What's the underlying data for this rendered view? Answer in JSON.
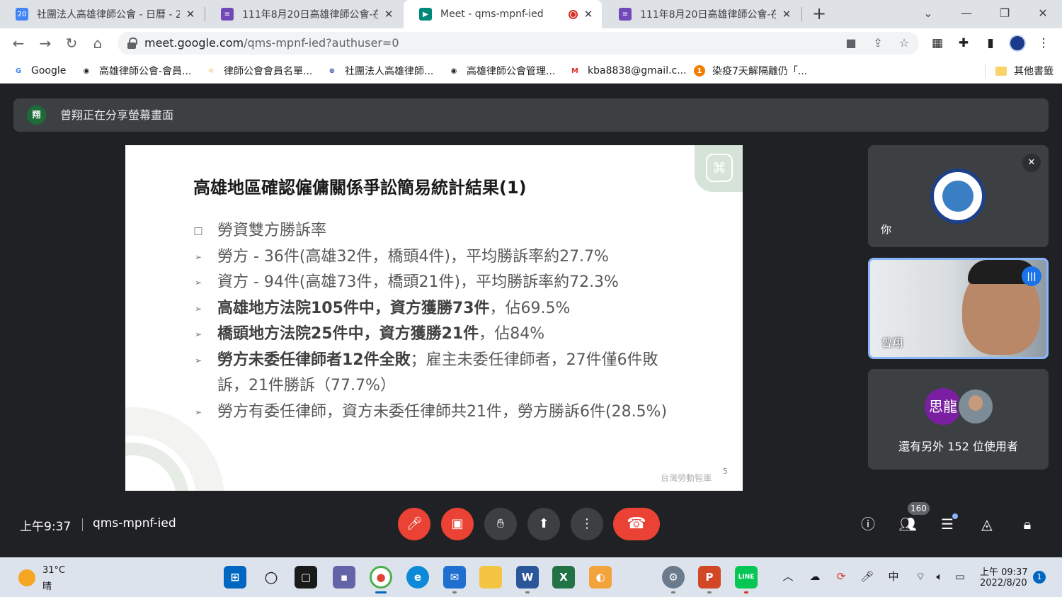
{
  "tabs": [
    {
      "title": "社團法人高雄律師公會 - 日曆 - 2",
      "favicon_text": "20",
      "favicon_color": "#4285f4"
    },
    {
      "title": "111年8月20日高雄律師公會-在",
      "favicon_text": "≡",
      "favicon_color": "#7248b9"
    },
    {
      "title": "Meet - qms-mpnf-ied",
      "favicon_text": "▶",
      "favicon_color": "#00897b"
    },
    {
      "title": "111年8月20日高雄律師公會-在",
      "favicon_text": "≡",
      "favicon_color": "#7248b9"
    }
  ],
  "address": {
    "url_host": "meet.google.com",
    "url_rest": "/qms-mpnf-ied?authuser=0"
  },
  "bookmarks": [
    {
      "label": "Google",
      "icon": "G",
      "icon_color": "#4285f4"
    },
    {
      "label": "高雄律師公會-會員...",
      "icon": "◉",
      "icon_color": "#202124"
    },
    {
      "label": "律師公會會員名單...",
      "icon": "☼",
      "icon_color": "#e0a030"
    },
    {
      "label": "社團法人高雄律師...",
      "icon": "⊕",
      "icon_color": "#3a4fa8"
    },
    {
      "label": "高雄律師公會管理...",
      "icon": "◉",
      "icon_color": "#202124"
    },
    {
      "label": "kba8838@gmail.c...",
      "icon": "M",
      "icon_color": "#d93025"
    },
    {
      "label": "染疫7天解隔離仍「...",
      "icon": "1",
      "icon_color": "#f07c00"
    },
    {
      "label": "其他書籤",
      "icon": "folder",
      "icon_color": "#f9d46c"
    }
  ],
  "meet": {
    "share_banner": "曾翔正在分享螢幕畫面",
    "presenter_initial": "翔",
    "slide": {
      "title": "高雄地區確認僱傭關係爭訟簡易統計結果(1)",
      "items": [
        {
          "bullet": "square",
          "text": "勞資雙方勝訴率",
          "bold": ""
        },
        {
          "bullet": "arrow",
          "text": "勞方 - 36件(高雄32件，橋頭4件)，平均勝訴率約27.7%",
          "bold": ""
        },
        {
          "bullet": "arrow",
          "text": "資方 - 94件(高雄73件，橋頭21件)，平均勝訴率約72.3%",
          "bold": ""
        },
        {
          "bullet": "arrow",
          "bold": "高雄地方法院105件中，資方獲勝73件",
          "text": "，佔69.5%"
        },
        {
          "bullet": "arrow",
          "bold": "橋頭地方法院25件中，資方獲勝21件",
          "text": "，佔84%"
        },
        {
          "bullet": "arrow",
          "bold": "勞方未委任律師者12件全敗",
          "text": "；雇主未委任律師者，27件僅6件敗訴，21件勝訴（77.7%）"
        },
        {
          "bullet": "arrow",
          "text": "勞方有委任律師，資方未委任律師共21件，勞方勝訴6件(28.5%)",
          "bold": ""
        }
      ],
      "footer": "台灣勞動智庫",
      "page_number": "5"
    },
    "participants": {
      "you_label": "你",
      "speaker_name": "曾翔",
      "others_initial": "思龍",
      "others_text": "還有另外 152 位使用者"
    },
    "clock": "上午9:37",
    "meeting_code": "qms-mpnf-ied",
    "people_count": "160"
  },
  "taskbar": {
    "temperature": "31°C",
    "weather": "晴",
    "time": "上午 09:37",
    "date": "2022/8/20",
    "ime": "中",
    "notification_count": "1"
  }
}
